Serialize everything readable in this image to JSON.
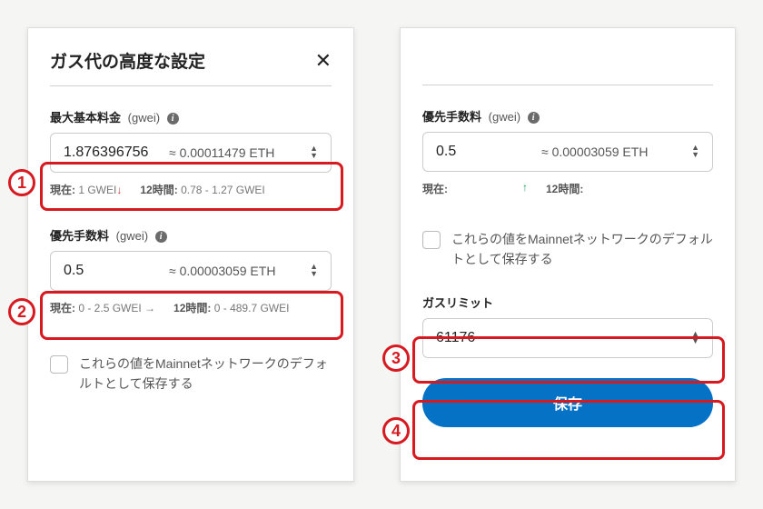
{
  "left": {
    "title": "ガス代の高度な設定",
    "max_base_fee": {
      "label": "最大基本料金",
      "unit": "(gwei)",
      "value": "1.876396756",
      "eth_est": "≈ 0.00011479 ETH",
      "status_current_label": "現在:",
      "status_current_value": "1 GWEI",
      "status_current_arrow": "↓",
      "status_12h_label": "12時間:",
      "status_12h_value": "0.78 - 1.27 GWEI"
    },
    "priority_fee": {
      "label": "優先手数料",
      "unit": "(gwei)",
      "value": "0.5",
      "eth_est": "≈ 0.00003059 ETH",
      "status_current_label": "現在:",
      "status_current_value": "0 - 2.5 GWEI",
      "status_current_arrow": "→",
      "status_12h_label": "12時間:",
      "status_12h_value": "0 - 489.7 GWEI"
    },
    "save_default_label": "これらの値をMainnetネットワークのデフォルトとして保存する"
  },
  "right": {
    "priority_fee": {
      "label": "優先手数料",
      "unit": "(gwei)",
      "value": "0.5",
      "eth_est": "≈ 0.00003059 ETH",
      "status_current_label": "現在:",
      "status_current_arrow": "↑",
      "status_12h_label": "12時間:"
    },
    "save_default_label": "これらの値をMainnetネットワークのデフォルトとして保存する",
    "gas_limit": {
      "label": "ガスリミット",
      "value": "61176"
    },
    "save_button": "保存"
  },
  "callouts": {
    "c1": "1",
    "c2": "2",
    "c3": "3",
    "c4": "4"
  }
}
